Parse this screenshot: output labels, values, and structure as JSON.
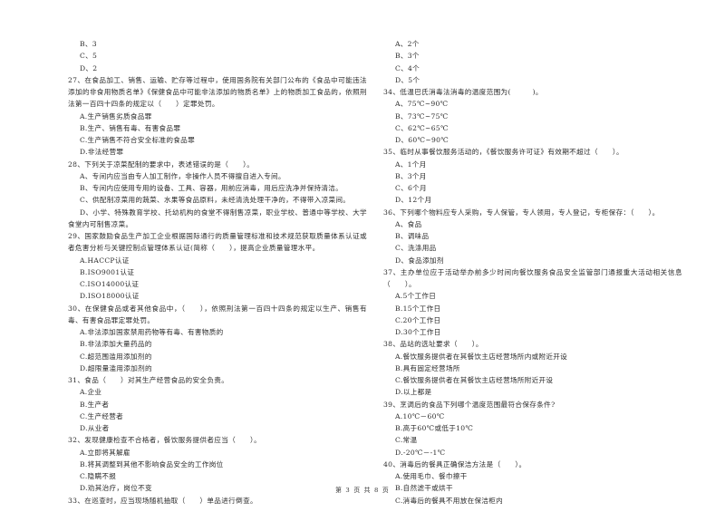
{
  "left_column": {
    "prev_options": [
      "B、3",
      "C、5",
      "D、2"
    ],
    "questions": [
      {
        "stem": "27、在食品加工、销售、运输、贮存等过程中，使用国务院有关部门公布的《食品中可能违法添加的非食用物质名单》《保健食品中可能非法添加的物质名单》上的物质加工食品的，依照刑法第一百四十四条的规定以（　　）定罪处罚。",
        "options": [
          "A.生产销售劣质食品罪",
          "B.生产、销售有毒、有害食品罪",
          "C.生产销售不符合安全标准的食品罪",
          "D.非法经营罪"
        ]
      },
      {
        "stem": "28、下列关于凉菜配制的要求中，表述错误的是（　　）。",
        "options": [
          "A、专间内应当由专人加工制作，非操作人员不得擅自进入专间。",
          "B、专间内应使用专用的设备、工具、容器，用前应消毒，用后应洗净并保持清洁。",
          "C、供配制凉菜用的蔬菜、水果等食品原料，未经清洗处理干净的，不得带入凉菜间。",
          "D、小学、特殊教育学校、托幼机构的食堂不得制售凉菜，职业学校、普通中等学校、大学食堂内可制售凉菜。"
        ]
      },
      {
        "stem": "29、国家鼓励食品生产加工企业根据国际通行的质量管理标准和技术规范获取质量体系认证或者危害分析与关键控制点管理体系认证(简称（　　），提高企业质量管理水平。",
        "options": [
          "A.HACCP认证",
          "B.ISO9001认证",
          "C.ISO14000认证",
          "D.ISO18000认证"
        ]
      },
      {
        "stem": "30、在保健食品或者其他食品中，（　　），依照刑法第一百四十四条的规定以生产、销售有毒、有害食品罪定罪处罚。",
        "options": [
          "A.非法添加国家禁用药物等有毒、有害物质的",
          "B.非法添加大量药品的",
          "C.超范围滥用添加剂的",
          "D.超限量滥用添加剂的"
        ]
      },
      {
        "stem": "31、食品（　　）对其生产经营食品的安全负责。",
        "options": [
          "A.企业",
          "B.生产者",
          "C.生产经营者",
          "D.从业者"
        ]
      },
      {
        "stem": "32、发现健康检查不合格者，餐饮服务提供者应当（　　）。",
        "options": [
          "A.立即将其解雇",
          "B.将其调整到其他不影响食品安全的工作岗位",
          "C.隐瞒不报",
          "D.劝其治疗，岗位不变"
        ]
      },
      {
        "stem": "33、在巡查时，应当现场随机抽取（　　）单品进行倒查。",
        "options": []
      }
    ]
  },
  "right_column": {
    "prev_options": [
      "A、2个",
      "B、3个",
      "C、4个",
      "D、5个"
    ],
    "questions": [
      {
        "stem": "34、低温巴氏消毒法消毒的温度范围为(　　　)。",
        "options": [
          "A、75℃~90℃",
          "B、73℃~75℃",
          "C、62℃~65℃",
          "D、60℃~90℃"
        ]
      },
      {
        "stem": "35、临时从事餐饮服务活动的，《餐饮服务许可证》有效期不超过（　　）。",
        "options": [
          "A、1个月",
          "B、3个月",
          "C、6个月",
          "D、12个月"
        ]
      },
      {
        "stem": "36、下列哪个物料应专人采购，专人保管，专人领用，专人登记，专柜保存：（　　）。",
        "options": [
          "A、食品",
          "B、调味品",
          "C、洗涤用品",
          "D、食品添加剂"
        ]
      },
      {
        "stem": "37、主办单位应于活动举办前多少时间向餐饮服务食品安全监管部门通报重大活动相关信息（　　）。",
        "options": [
          "A.5个工作日",
          "B.15个工作日",
          "C.20个工作日",
          "D.30个工作日"
        ]
      },
      {
        "stem": "38、品站的选址要求（　　）。",
        "options": [
          "A.餐饮服务提供者在其餐饮主店经营场所内或附近开设",
          "B.具有固定经营场所",
          "C.餐饮服务提供者在其餐饮主店经营场所附近开设",
          "D.以上都是"
        ]
      },
      {
        "stem": "39、烹调后的食品下列哪个温度范围最符合保存条件?",
        "options": [
          "A.10℃－60℃",
          "B.高于60℃或低于10℃",
          "C.常温",
          "D.-20℃－-1℃"
        ]
      },
      {
        "stem": "40、消毒后的餐具正确保洁方法是（　　）。",
        "options": [
          "A.使用毛巾、餐巾擦干",
          "B.自然滤干或烘干",
          "C.消毒后的餐具不用放在保洁柜内"
        ]
      }
    ]
  },
  "footer": {
    "page_label": "第 3 页 共 8 页"
  }
}
